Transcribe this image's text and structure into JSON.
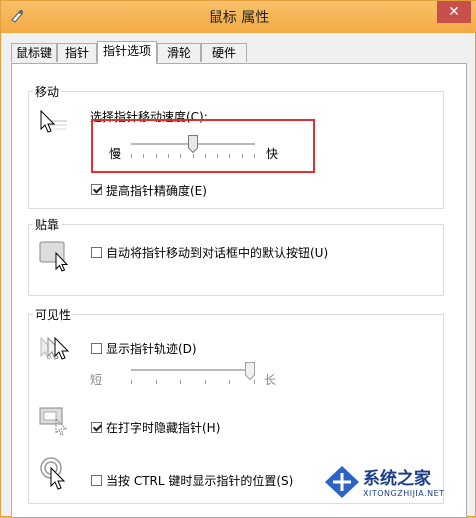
{
  "window": {
    "title": "鼠标 属性",
    "close_glyph": "✕",
    "accent_color": "#f3aa42"
  },
  "tabs": [
    {
      "label": "鼠标键",
      "active": false
    },
    {
      "label": "指针",
      "active": false
    },
    {
      "label": "指针选项",
      "active": true
    },
    {
      "label": "滑轮",
      "active": false
    },
    {
      "label": "硬件",
      "active": false
    }
  ],
  "motion": {
    "group_label": "移动",
    "speed_label": "选择指针移动速度(C):",
    "slow_label": "慢",
    "fast_label": "快",
    "speed_value": 0.5,
    "precision_label": "提高指针精确度(E)",
    "precision_checked": true,
    "icon": "pointer-speed-icon"
  },
  "snap": {
    "group_label": "贴靠",
    "snap_label": "自动将指针移动到对话框中的默认按钮(U)",
    "snap_checked": false,
    "icon": "snap-to-button-icon"
  },
  "visibility": {
    "group_label": "可见性",
    "trails_label": "显示指针轨迹(D)",
    "trails_checked": false,
    "short_label": "短",
    "long_label": "长",
    "trails_value": 1.0,
    "hide_label": "在打字时隐藏指针(H)",
    "hide_checked": true,
    "ctrl_label": "当按 CTRL 键时显示指针的位置(S)",
    "ctrl_checked": false,
    "icons": [
      "pointer-trails-icon",
      "hide-pointer-icon",
      "pointer-location-icon"
    ]
  },
  "watermark": {
    "text": "系统之家",
    "sub": "XITONGZHIJIA.NET"
  }
}
